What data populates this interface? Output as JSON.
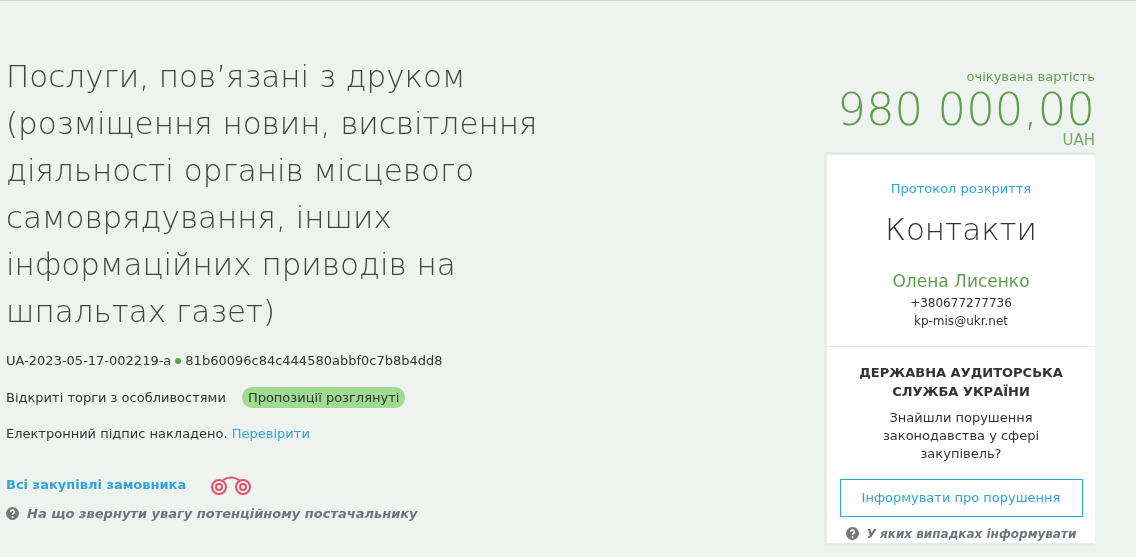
{
  "title": "Послуги, пов’язані з друком (розміщення новин, висвітлення діяльності органів місцевого самоврядування, інших інформаційних приводів на шпальтах газет)",
  "tender_id": "UA-2023-05-17-002219-a",
  "hash": "81b60096c84c444580abbf0c7b8b4dd8",
  "procedure": "Відкриті торги з особливостями",
  "status": "Пропозиції розглянуті",
  "signature": {
    "text": "Електронний підпис накладено.",
    "link": "Перевірити"
  },
  "buyer_link": "Всі закупівлі замовника",
  "hint": "На що звернути увагу потенційному постачальнику",
  "value": {
    "label": "очікувана вартість",
    "amount": "980 000,00",
    "currency": "UAH"
  },
  "contacts": {
    "protocol_link": "Протокол розкриття",
    "heading": "Контакти",
    "name": "Олена Лисенко",
    "phone": "+380677277736",
    "email": "kp-mis@ukr.net"
  },
  "audit": {
    "title": "ДЕРЖАВНА АУДИТОРСЬКА СЛУЖБА УКРАЇНИ",
    "question": "Знайшли порушення законодавства у сфері закупівель?",
    "button": "Інформувати про порушення",
    "hint": "У яких випадках інформувати"
  }
}
